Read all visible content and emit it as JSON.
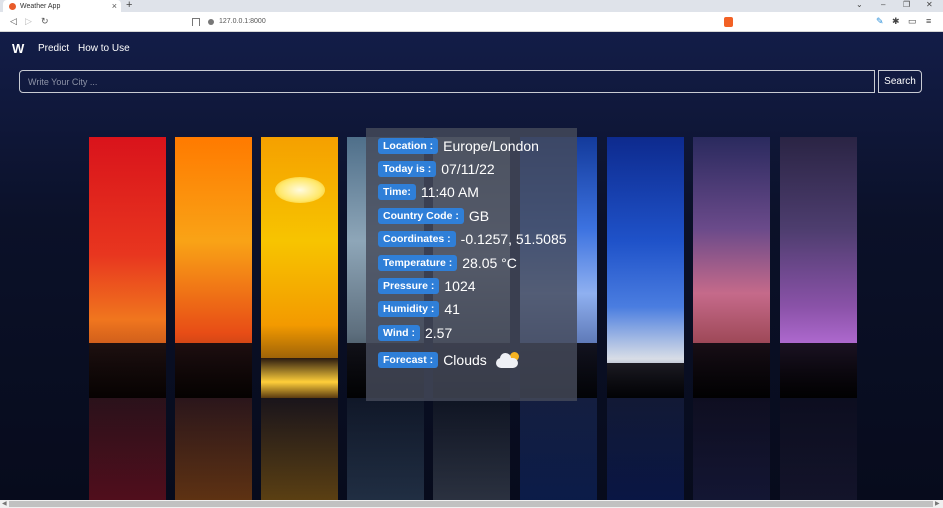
{
  "browser": {
    "tab_title": "Weather App",
    "tab_close": "×",
    "new_tab": "+",
    "url": "127.0.0.1:8000",
    "controls": {
      "minimize": "–",
      "restore": "❐",
      "close": "✕",
      "menu": "⌄"
    }
  },
  "navbar": {
    "brand": "W",
    "links": [
      "Predict",
      "How to Use"
    ]
  },
  "search": {
    "placeholder": "Write Your City ...",
    "button_label": "Search"
  },
  "weather": {
    "rows": [
      {
        "label": "Location :",
        "value": "Europe/London"
      },
      {
        "label": "Today is :",
        "value": "07/11/22"
      },
      {
        "label": "Time:",
        "value": "11:40 AM"
      },
      {
        "label": "Country Code :",
        "value": "GB"
      },
      {
        "label": "Coordinates :",
        "value": "-0.1257, 51.5085"
      },
      {
        "label": "Temperature :",
        "value": "28.05 °C"
      },
      {
        "label": "Pressure :",
        "value": "1024"
      },
      {
        "label": "Humidity :",
        "value": "41"
      },
      {
        "label": "Wind :",
        "value": "2.57"
      },
      {
        "label": "Forecast :",
        "value": "Clouds",
        "icon": "cloud-sun-icon"
      }
    ]
  },
  "colors": {
    "label_bg": "#2f7fd8",
    "card_bg": "#464a5a",
    "page_bg": "#0b1129"
  }
}
